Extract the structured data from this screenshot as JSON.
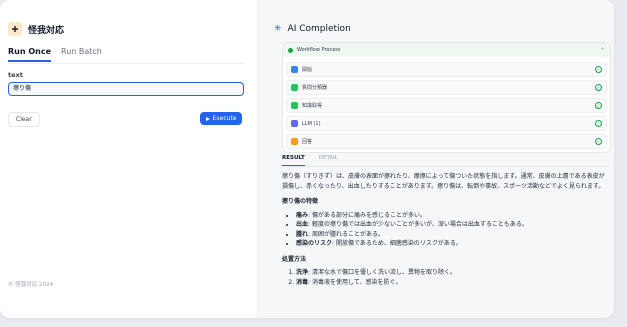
{
  "app": {
    "title": "怪我対応",
    "icon": "first-aid-icon",
    "footer": "© 怪我対応 2024"
  },
  "tabs": [
    "Run Once",
    "Run Batch"
  ],
  "form": {
    "label": "text",
    "value": "擦り傷"
  },
  "buttons": {
    "clear": "Clear",
    "execute": "Execute"
  },
  "panel": {
    "title": "AI Completion"
  },
  "workflow": {
    "title": "Workflow Process",
    "steps": [
      {
        "label": "開始",
        "color": "#3b82f6",
        "icon": "start-icon"
      },
      {
        "label": "質問分類器",
        "color": "#22c55e",
        "icon": "classifier-icon"
      },
      {
        "label": "知識取得",
        "color": "#22c55e",
        "icon": "knowledge-icon"
      },
      {
        "label": "LLM (1)",
        "color": "#6366f1",
        "icon": "llm-icon"
      },
      {
        "label": "回答",
        "color": "#f59e0b",
        "icon": "answer-icon"
      }
    ]
  },
  "result_tabs": [
    "RESULT",
    "DETAIL"
  ],
  "result": {
    "intro": "擦り傷（すりきず）は、皮膚の表面が擦れたり、摩擦によって傷ついた状態を指します。通常、皮膚の上層である表皮が損傷し、赤くなったり、出血したりすることがあります。擦り傷は、転倒や事故、スポーツ活動などでよく見られます。",
    "features_heading": "擦り傷の特徴",
    "features": [
      {
        "term": "痛み",
        "desc": ": 傷がある部分に痛みを感じることが多い。"
      },
      {
        "term": "出血",
        "desc": ": 軽度の擦り傷では出血が少ないことが多いが、深い場合は出血することもある。"
      },
      {
        "term": "腫れ",
        "desc": ": 周囲が腫れることがある。"
      },
      {
        "term": "感染のリスク",
        "desc": ": 開放傷であるため、細菌感染のリスクがある。"
      }
    ],
    "treatment_heading": "処置方法",
    "treatments": [
      {
        "term": "洗浄",
        "desc": ": 清潔な水で傷口を優しく洗い流し、異物を取り除く。"
      },
      {
        "term": "消毒",
        "desc": ": 消毒液を使用して、感染を防ぐ。"
      }
    ]
  }
}
